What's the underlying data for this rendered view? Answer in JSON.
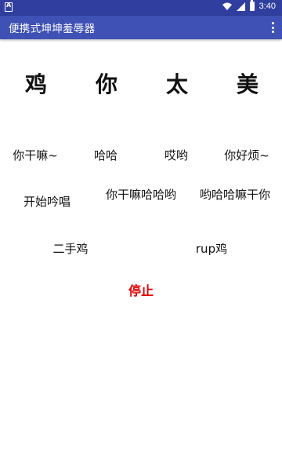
{
  "status_bar": {
    "time": "3:40",
    "icons": [
      "notification-a-icon",
      "wifi-icon",
      "signal-icon",
      "battery-icon"
    ]
  },
  "app_bar": {
    "title": "便携式坤坤羞辱器",
    "overflow_icon": "more-vert-icon"
  },
  "title_chars": [
    "鸡",
    "你",
    "太",
    "美"
  ],
  "row1": [
    "你干嘛~",
    "哈哈",
    "哎哟",
    "你好烦~"
  ],
  "row2": [
    "开始吟唱",
    "你干嘛哈哈哟",
    "哟哈哈嘛干你"
  ],
  "row3": [
    "二手鸡",
    "rup鸡"
  ],
  "stop_label": "停止",
  "colors": {
    "status_bar": "#303f9f",
    "app_bar": "#3f51b5",
    "stop": "#e00000"
  }
}
